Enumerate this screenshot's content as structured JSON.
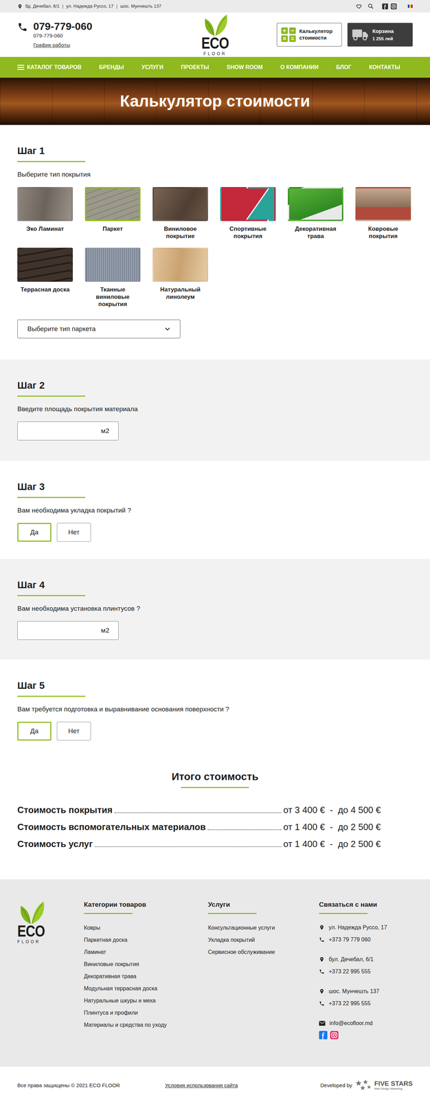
{
  "topbar": {
    "addresses": [
      "бд. Дечебал, 6/1",
      "ул. Надежда Руссо, 17",
      "шос. Мунчешть 137"
    ],
    "separator": "|"
  },
  "header": {
    "phone": "079-779-060",
    "phone_alt": "079-779-060",
    "schedule": "График работы",
    "logo": {
      "word": "ECO",
      "sub": "FLOOR"
    },
    "calculator": "Калькулятор стоимости",
    "cart": {
      "label": "Корзина",
      "amount": "1 255 лей"
    }
  },
  "nav": {
    "items": [
      "КАТАЛОГ ТОВАРОВ",
      "БРЕНДЫ",
      "УСЛУГИ",
      "ПРОЕКТЫ",
      "SHOW ROOM",
      "О КОМПАНИИ",
      "БЛОГ",
      "КОНТАКТЫ"
    ]
  },
  "hero": {
    "title": "Калькулятор стоимости"
  },
  "steps": [
    {
      "kind": "tiles",
      "title": "Шаг 1",
      "prompt": "Выберите тип покрытия",
      "tiles": [
        {
          "label": "Эко Ламинат",
          "selected": false
        },
        {
          "label": "Паркет",
          "selected": true
        },
        {
          "label": "Виниловое покрытие",
          "selected": false
        },
        {
          "label": "Спортивные покрытия",
          "selected": false
        },
        {
          "label": "Декоративная трава",
          "selected": false
        },
        {
          "label": "Ковровые покрытия",
          "selected": false
        },
        {
          "label": "Террасная доска",
          "selected": false
        },
        {
          "label": "Тканные виниловые покрытия",
          "selected": false
        },
        {
          "label": "Натуральный линолеум",
          "selected": false
        }
      ],
      "select": "Выберите тип паркета"
    },
    {
      "kind": "area",
      "title": "Шаг 2",
      "prompt": "Введите площадь покрытия материала",
      "unit": "м2"
    },
    {
      "kind": "choice",
      "title": "Шаг 3",
      "prompt": "Вам необходима укладка покрытий ?",
      "options": [
        {
          "label": "Да",
          "selected": true
        },
        {
          "label": "Нет",
          "selected": false
        }
      ]
    },
    {
      "kind": "area",
      "title": "Шаг 4",
      "prompt": "Вам необходима установка плинтусов ?",
      "unit": "м2"
    },
    {
      "kind": "choice",
      "title": "Шаг 5",
      "prompt": "Вам требуется подготовка и выравнивание основания поверхности ?",
      "options": [
        {
          "label": "Да",
          "selected": true
        },
        {
          "label": "Нет",
          "selected": false
        }
      ]
    }
  ],
  "total": {
    "title": "Итого стоимость",
    "rows": [
      {
        "label": "Стоимость покрытия",
        "value": "от 3 400 €  -  до 4 500 €"
      },
      {
        "label": "Стоимость вспомогательных материалов",
        "value": "от 1 400 €  -  до 2 500 €"
      },
      {
        "label": "Стоимость услуг",
        "value": "от 1 400 €  -  до 2 500 €"
      }
    ]
  },
  "footer": {
    "logo": {
      "word": "ECO",
      "sub": "FLOOR"
    },
    "categories": {
      "title": "Категории товаров",
      "items": [
        "Ковры",
        "Паркетная доска",
        "Ламинат",
        "Виниловые покрытия",
        "Декоративная трава",
        "Модульная террасная доска",
        "Натуральные шкуры и меха",
        "Плинтуса и профили",
        "Материалы и средства по уходу"
      ]
    },
    "services": {
      "title": "Услуги",
      "items": [
        "Консультационные услуги",
        "Укладка покрытий",
        "Сервисное обслуживание"
      ]
    },
    "contacts": {
      "title": "Связаться с нами",
      "places": [
        {
          "address": "ул. Надежда Руссо, 17",
          "phone": "+373 79 779 060"
        },
        {
          "address": "бул. Дечебал, 6/1",
          "phone": "+373 22 995 555"
        },
        {
          "address": "шос. Мунчешть 137",
          "phone": "+373 22 995 555"
        }
      ],
      "email": "info@ecofloor.md"
    },
    "copyright": "Все права защищены © 2021 ECO FLOOR",
    "terms": "Условия использования сайта",
    "developed_by": "Developed by",
    "developer": {
      "name": "FIVE STARS",
      "tagline": "Web Design Marketing."
    }
  }
}
